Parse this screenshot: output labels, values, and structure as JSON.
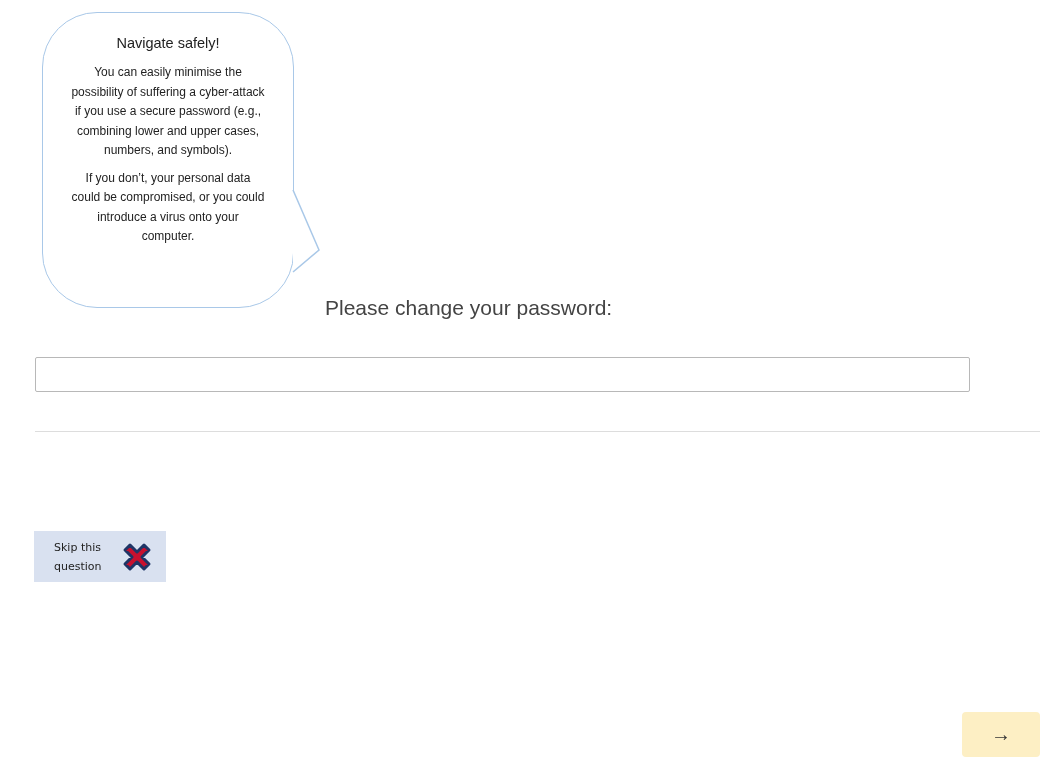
{
  "tip": {
    "title": "Navigate safely!",
    "paragraphs": [
      "You can easily minimise the possibility of suffering a cyber-attack if you use a secure password (e.g., combining lower and upper cases, numbers, and symbols).",
      "If you don’t, your personal data could be compromised, or you could introduce a virus onto your computer."
    ]
  },
  "question": {
    "prompt": "Please change your password:"
  },
  "skip_button": {
    "label": "Skip this question"
  },
  "next_button": {
    "label": "→"
  }
}
